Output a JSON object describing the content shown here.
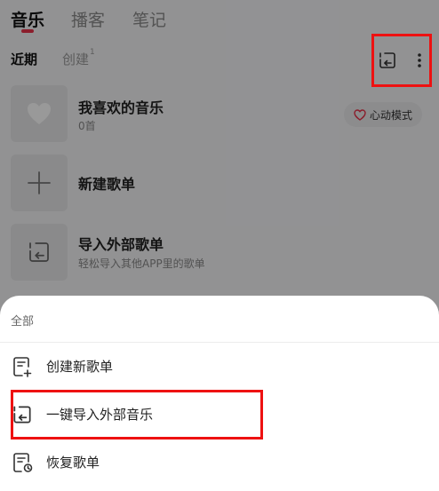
{
  "top_tabs": {
    "music": "音乐",
    "podcast": "播客",
    "notes": "笔记",
    "active": "music"
  },
  "sub_tabs": {
    "recent": "近期",
    "created": "创建",
    "created_count": "1",
    "active": "recent"
  },
  "icons": {
    "import": "import-icon",
    "more": "more-vertical-icon",
    "heart": "heart-icon",
    "plus": "plus-icon"
  },
  "playlists": [
    {
      "title": "我喜欢的音乐",
      "subtitle": "0首",
      "action": "心动模式"
    },
    {
      "title": "新建歌单"
    },
    {
      "title": "导入外部歌单",
      "subtitle": "轻松导入其他APP里的歌单"
    }
  ],
  "sheet": {
    "header": "全部",
    "items": [
      {
        "label": "创建新歌单",
        "icon": "create-playlist-icon"
      },
      {
        "label": "一键导入外部音乐",
        "icon": "import-music-icon"
      },
      {
        "label": "恢复歌单",
        "icon": "restore-playlist-icon"
      }
    ]
  },
  "colors": {
    "accent": "#e8324a",
    "highlight_box": "#e11111",
    "overlay": "rgba(0,0,0,0.40)",
    "sheet_bg": "#ffffff"
  }
}
